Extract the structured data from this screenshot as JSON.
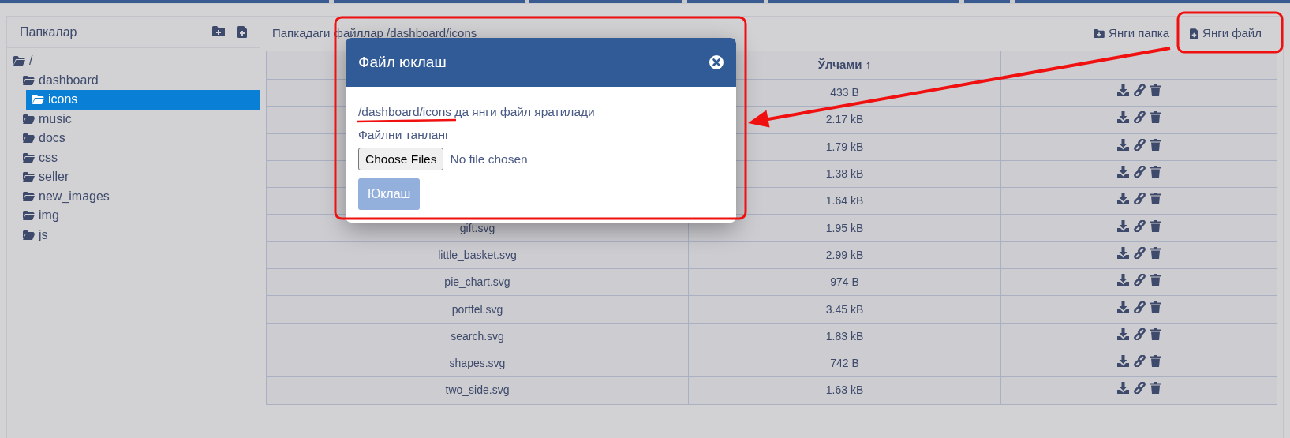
{
  "sidebar": {
    "title": "Папкалар",
    "tree": [
      {
        "label": "/",
        "selected": false,
        "children": [
          {
            "label": "dashboard",
            "selected": false,
            "children": [
              {
                "label": "icons",
                "selected": true
              }
            ]
          },
          {
            "label": "music",
            "selected": false
          },
          {
            "label": "docs",
            "selected": false
          },
          {
            "label": "css",
            "selected": false
          },
          {
            "label": "seller",
            "selected": false
          },
          {
            "label": "new_images",
            "selected": false
          },
          {
            "label": "img",
            "selected": false
          },
          {
            "label": "js",
            "selected": false
          }
        ]
      }
    ]
  },
  "main": {
    "title": "Папкадаги файллар /dashboard/icons",
    "actions": [
      {
        "label": "Янги папка",
        "kind": "folder"
      },
      {
        "label": "Янги файл",
        "kind": "file"
      }
    ],
    "table": {
      "size_column": {
        "label": "Ўлчами",
        "sort_mark": "↑"
      },
      "rows": [
        {
          "size": "433 B"
        },
        {
          "size": "2.17 kB"
        },
        {
          "size": "1.79 kB"
        },
        {
          "size": "1.38 kB"
        },
        {
          "size": "1.64 kB"
        },
        {
          "name": "gift.svg",
          "size": "1.95 kB"
        },
        {
          "name": "little_basket.svg",
          "size": "2.99 kB"
        },
        {
          "name": "pie_chart.svg",
          "size": "974 B"
        },
        {
          "name": "portfel.svg",
          "size": "3.45 kB"
        },
        {
          "name": "search.svg",
          "size": "1.83 kB"
        },
        {
          "name": "shapes.svg",
          "size": "742 B"
        },
        {
          "name": "two_side.svg",
          "size": "1.63 kB"
        }
      ]
    }
  },
  "modal": {
    "title": "Файл юклаш",
    "path": "/dashboard/icons",
    "message": "да янги файл яратилади",
    "field_label": "Файлни танланг",
    "file_button": "Choose Files",
    "file_status": "No file chosen",
    "submit": {
      "label": "Юклаш",
      "disabled": true
    }
  }
}
